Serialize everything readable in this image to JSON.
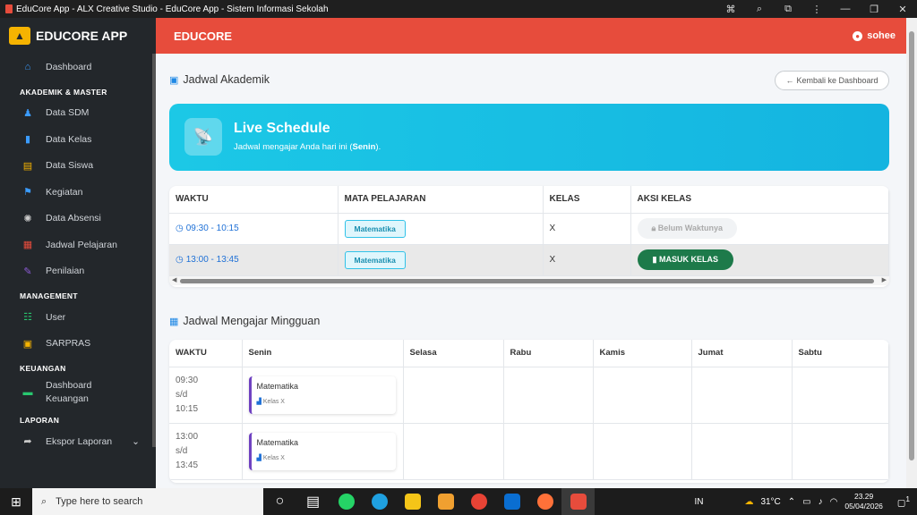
{
  "window": {
    "title": "EduCore App - ALX Creative Studio - EduCore App - Sistem Informasi Sekolah"
  },
  "sidebar": {
    "brand": "EDUCORE APP",
    "items": [
      {
        "type": "item",
        "label": "Dashboard",
        "icon": "home-icon",
        "color": "#3b9cff"
      },
      {
        "type": "head",
        "label": "AKADEMIK & MASTER"
      },
      {
        "type": "item",
        "label": "Data SDM",
        "icon": "user-tie-icon",
        "color": "#3b9cff"
      },
      {
        "type": "item",
        "label": "Data Kelas",
        "icon": "door-icon",
        "color": "#3b9cff"
      },
      {
        "type": "item",
        "label": "Data Siswa",
        "icon": "id-card-icon",
        "color": "#f5b301"
      },
      {
        "type": "item",
        "label": "Kegiatan",
        "icon": "running-icon",
        "color": "#3b9cff"
      },
      {
        "type": "item",
        "label": "Data Absensi",
        "icon": "fingerprint-icon",
        "color": "#ccc"
      },
      {
        "type": "item",
        "label": "Jadwal Pelajaran",
        "icon": "calendar-icon",
        "color": "#e74c3c"
      },
      {
        "type": "item",
        "label": "Penilaian",
        "icon": "pen-icon",
        "color": "#8e5cd9"
      },
      {
        "type": "head",
        "label": "MANAGEMENT"
      },
      {
        "type": "item",
        "label": "User",
        "icon": "users-icon",
        "color": "#28c76f"
      },
      {
        "type": "item",
        "label": "SARPRAS",
        "icon": "boxes-icon",
        "color": "#f5b301"
      },
      {
        "type": "head",
        "label": "KEUANGAN"
      },
      {
        "type": "item",
        "label": "Dashboard Keuangan",
        "icon": "wallet-icon",
        "color": "#28c76f",
        "multi": true
      },
      {
        "type": "head",
        "label": "LAPORAN"
      },
      {
        "type": "item",
        "label": "Ekspor Laporan",
        "icon": "file-export-icon",
        "color": "#ccc",
        "chevron": "⌄"
      }
    ]
  },
  "header": {
    "title": "EDUCORE",
    "user": "sohee"
  },
  "academic": {
    "title": "Jadwal Akademik",
    "back_label": "Kembali ke Dashboard"
  },
  "hero": {
    "title": "Live Schedule",
    "sub_prefix": "Jadwal mengajar Anda hari ini (",
    "day": "Senin",
    "sub_suffix": ")."
  },
  "today": {
    "headers": [
      "WAKTU",
      "MATA PELAJARAN",
      "KELAS",
      "AKSI KELAS"
    ],
    "rows": [
      {
        "time": "09:30 - 10:15",
        "subject": "Matematika",
        "class": "X",
        "action": "Belum Waktunya",
        "status": "waiting"
      },
      {
        "time": "13:00 - 13:45",
        "subject": "Matematika",
        "class": "X",
        "action": "MASUK KELAS",
        "status": "enter"
      }
    ]
  },
  "weekly": {
    "title": "Jadwal Mengajar Mingguan",
    "headers": [
      "WAKTU",
      "Senin",
      "Selasa",
      "Rabu",
      "Kamis",
      "Jumat",
      "Sabtu"
    ],
    "rows": [
      {
        "start": "09:30",
        "sd": "s/d",
        "end": "10:15",
        "subject": "Matematika",
        "class": "Kelas X"
      },
      {
        "start": "13:00",
        "sd": "s/d",
        "end": "13:45",
        "subject": "Matematika",
        "class": "Kelas X"
      }
    ]
  },
  "taskbar": {
    "search_placeholder": "Type here to search",
    "lang": "IN",
    "temp": "31°C",
    "time": "23.29",
    "date": "05/04/2026",
    "notif_count": "1"
  }
}
